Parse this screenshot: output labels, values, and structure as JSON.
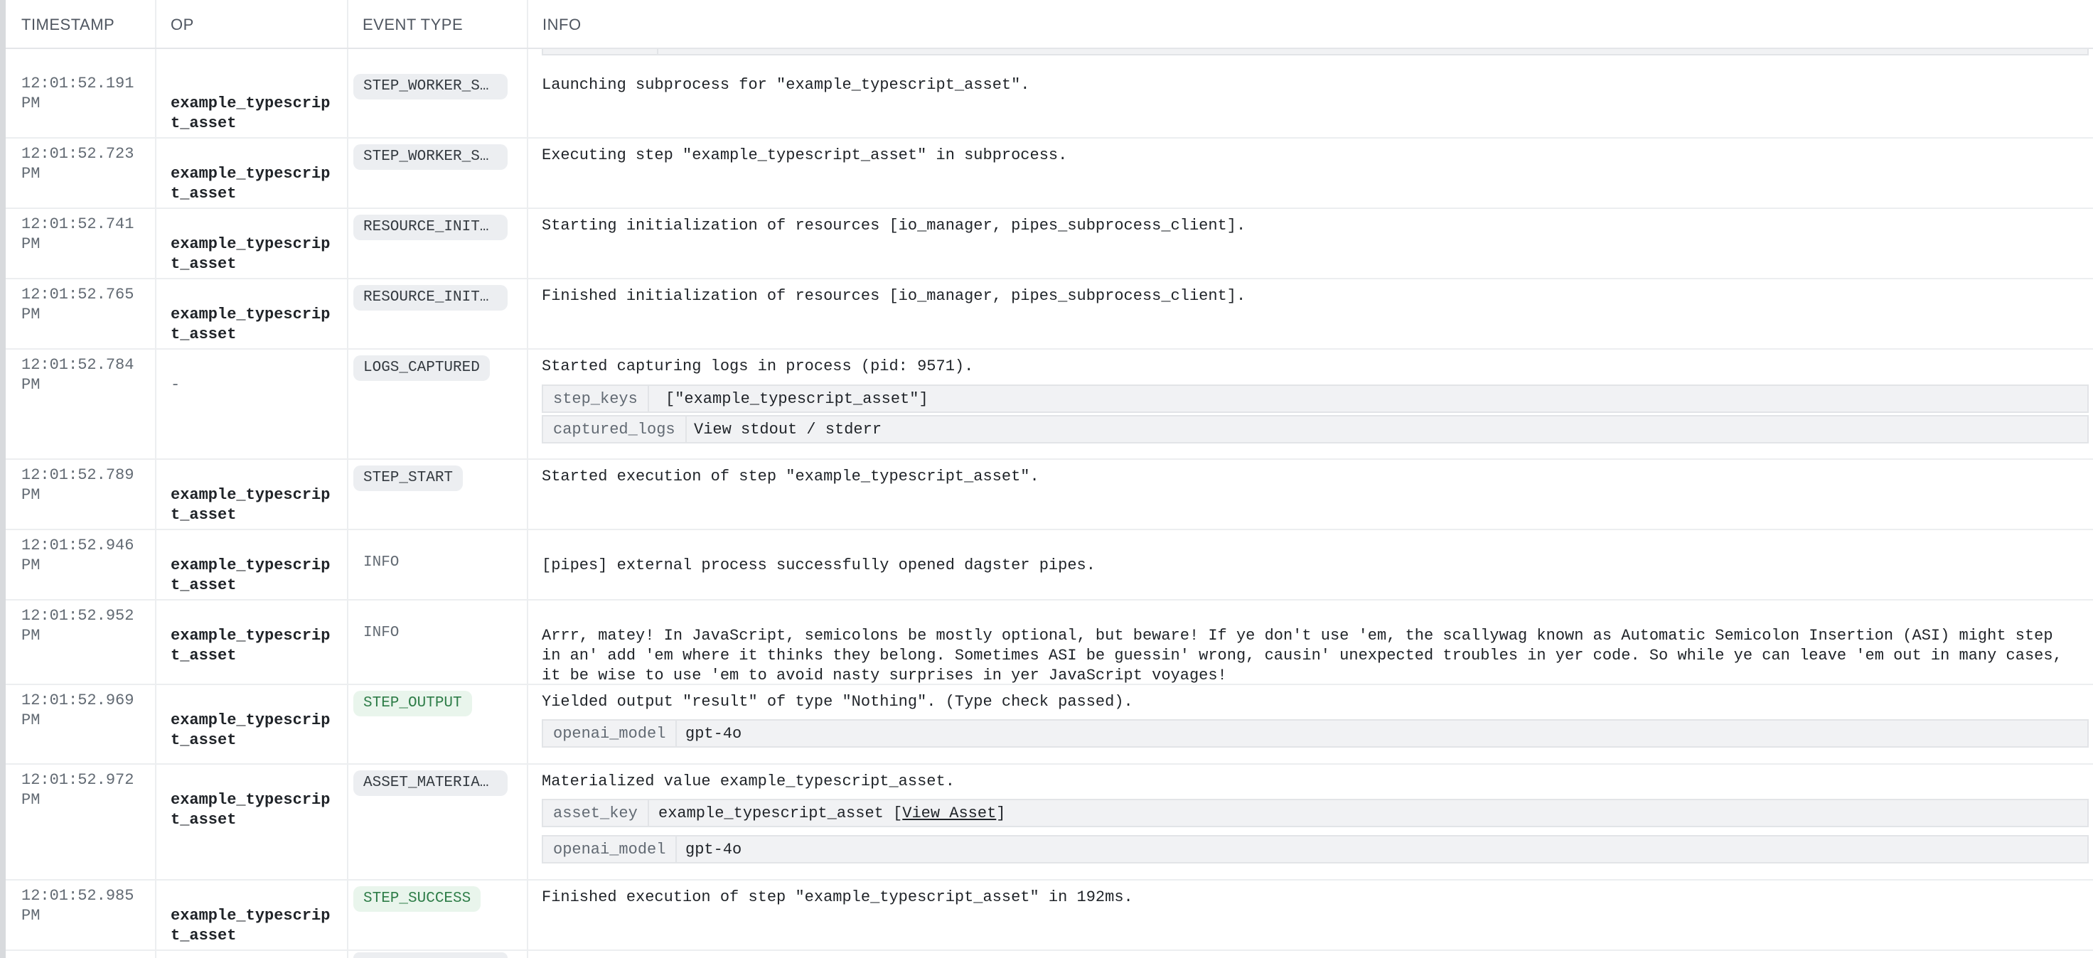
{
  "columns": {
    "timestamp": "TIMESTAMP",
    "op": "OP",
    "event_type": "EVENT TYPE",
    "info": "INFO"
  },
  "rows": [
    {
      "time": "12:01:52.191",
      "ampm": "PM",
      "op1": "example_typescrip",
      "op2": "t_asset",
      "event": "STEP_WORKER_STA…",
      "info": "Launching subprocess for \"example_typescript_asset\"."
    },
    {
      "time": "12:01:52.723",
      "ampm": "PM",
      "op1": "example_typescrip",
      "op2": "t_asset",
      "event": "STEP_WORKER_STA…",
      "info": "Executing step \"example_typescript_asset\" in subprocess."
    },
    {
      "time": "12:01:52.741",
      "ampm": "PM",
      "op1": "example_typescrip",
      "op2": "t_asset",
      "event": "RESOURCE_INIT_S…",
      "info": "Starting initialization of resources [io_manager, pipes_subprocess_client]."
    },
    {
      "time": "12:01:52.765",
      "ampm": "PM",
      "op1": "example_typescrip",
      "op2": "t_asset",
      "event": "RESOURCE_INIT_S…",
      "info": "Finished initialization of resources [io_manager, pipes_subprocess_client]."
    },
    {
      "time": "12:01:52.784",
      "ampm": "PM",
      "op": "-",
      "event": "LOGS_CAPTURED",
      "info": "Started capturing logs in process (pid: 9571).",
      "meta": [
        {
          "key": "step_keys",
          "value": "[\"example_typescript_asset\"]"
        },
        {
          "key": "captured_logs",
          "value": "View stdout / stderr"
        }
      ]
    },
    {
      "time": "12:01:52.789",
      "ampm": "PM",
      "op1": "example_typescrip",
      "op2": "t_asset",
      "event": "STEP_START",
      "info": "Started execution of step \"example_typescript_asset\"."
    },
    {
      "time": "12:01:52.946",
      "ampm": "PM",
      "op1": "example_typescrip",
      "op2": "t_asset",
      "event": "INFO",
      "info": "[pipes] external process successfully opened dagster pipes."
    },
    {
      "time": "12:01:52.952",
      "ampm": "PM",
      "op1": "example_typescrip",
      "op2": "t_asset",
      "event": "INFO",
      "info": "Arrr, matey! In JavaScript, semicolons be mostly optional, but beware! If ye don't use 'em, the scallywag known as Automatic Semicolon Insertion (ASI) might step in an' add 'em where it thinks they belong. Sometimes ASI be guessin' wrong, causin' unexpected troubles in yer code. So while ye can leave 'em out in many cases, it be wise to use 'em to avoid nasty surprises in yer JavaScript voyages!"
    },
    {
      "time": "12:01:52.969",
      "ampm": "PM",
      "op1": "example_typescrip",
      "op2": "t_asset",
      "event": "STEP_OUTPUT",
      "info": "Yielded output \"result\" of type \"Nothing\". (Type check passed).",
      "meta": [
        {
          "key": "openai_model",
          "value": "gpt-4o"
        }
      ]
    },
    {
      "time": "12:01:52.972",
      "ampm": "PM",
      "op1": "example_typescrip",
      "op2": "t_asset",
      "event": "ASSET_MATERIALI…",
      "info": "Materialized value example_typescript_asset.",
      "meta": [
        {
          "key": "asset_key",
          "value": "example_typescript_asset [",
          "link": "View Asset",
          "suffix": "]"
        },
        {
          "key": "openai_model",
          "value": "gpt-4o"
        }
      ]
    },
    {
      "time": "12:01:52.985",
      "ampm": "PM",
      "op1": "example_typescrip",
      "op2": "t_asset",
      "event": "STEP_SUCCESS",
      "info": "Finished execution of step \"example_typescript_asset\" in 192ms."
    }
  ],
  "colors": {
    "tag_bg": "#eceef1",
    "success_bg": "#e9f5ec",
    "success_text": "#2e7d48",
    "meta_bg": "#f1f2f4"
  }
}
